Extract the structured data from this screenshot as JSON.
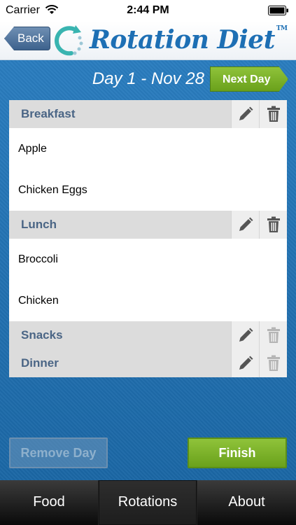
{
  "status_bar": {
    "carrier": "Carrier",
    "time": "2:44 PM"
  },
  "header": {
    "back_label": "Back",
    "app_name": "Rotation Diet",
    "trademark": "TM"
  },
  "day": {
    "title": "Day 1 - Nov 28",
    "next_day_label": "Next Day"
  },
  "meals": [
    {
      "name": "Breakfast",
      "items": [
        "Apple",
        "Chicken Eggs"
      ],
      "delete_enabled": true
    },
    {
      "name": "Lunch",
      "items": [
        "Broccoli",
        "Chicken"
      ],
      "delete_enabled": true
    },
    {
      "name": "Snacks",
      "items": [],
      "delete_enabled": false
    },
    {
      "name": "Dinner",
      "items": [],
      "delete_enabled": false
    }
  ],
  "actions": {
    "remove_day_label": "Remove Day",
    "finish_label": "Finish"
  },
  "tabs": [
    {
      "label": "Food",
      "active": false
    },
    {
      "label": "Rotations",
      "active": true
    },
    {
      "label": "About",
      "active": false
    }
  ],
  "colors": {
    "brand_blue": "#1d6fb4",
    "accent_green": "#7ab12a",
    "section_title": "#4a6585",
    "disabled_icon": "#b5b5b5",
    "active_icon": "#555555"
  }
}
